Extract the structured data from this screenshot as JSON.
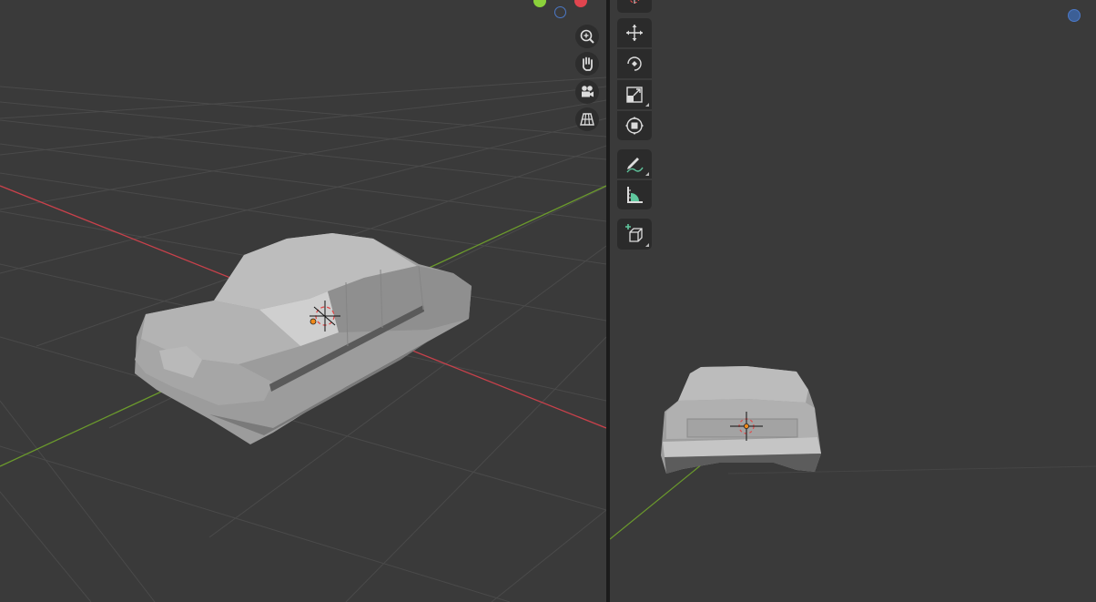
{
  "colors": {
    "background": "#3a3a3a",
    "grid_line": "#4a4a4a",
    "axis_x": "#c8414b",
    "axis_y": "#6b9a2c",
    "object": "#a9a9a9",
    "gizmo_y": "#8bd13b",
    "gizmo_x": "#e0454f",
    "gizmo_z": "#4c79c7",
    "tool_bg": "#2b2b2b",
    "annotate_accent": "#5fc79e"
  },
  "left_viewport": {
    "navigation_icons": [
      "zoom-icon",
      "hand-pan-icon",
      "camera-icon",
      "grid-perspective-icon"
    ]
  },
  "right_viewport": {
    "toolbar_tools": [
      "cursor-icon",
      "move-icon",
      "rotate-icon",
      "scale-icon",
      "transform-icon",
      "annotate-icon",
      "measure-icon",
      "add-cube-icon"
    ]
  }
}
